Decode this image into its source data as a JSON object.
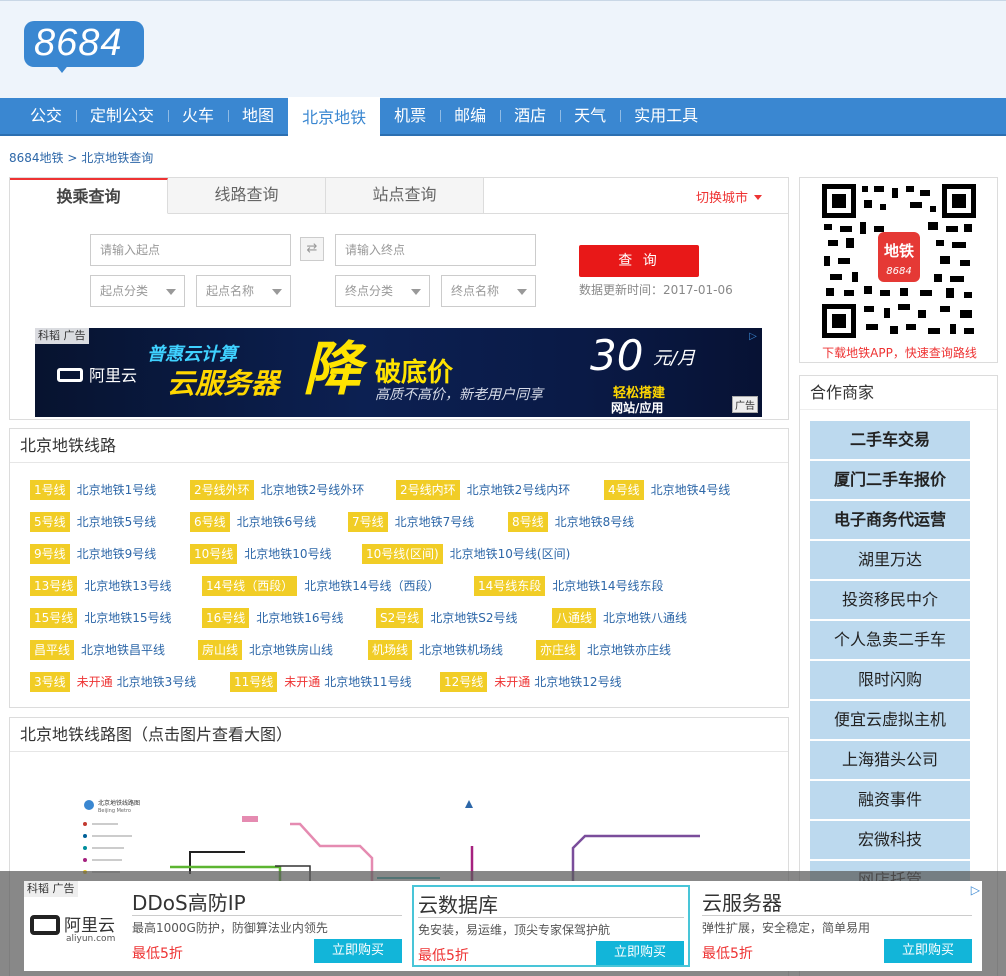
{
  "header": {
    "logo_text": "8684"
  },
  "nav": {
    "items": [
      "公交",
      "定制公交",
      "火车",
      "地图",
      "北京地铁",
      "机票",
      "邮编",
      "酒店",
      "天气",
      "实用工具"
    ],
    "active_index": 4
  },
  "breadcrumb": {
    "home": "8684地铁",
    "sep": " > ",
    "current": "北京地铁查询"
  },
  "query": {
    "tabs": [
      "换乘查询",
      "线路查询",
      "站点查询"
    ],
    "switch_city": "切换城市",
    "start_placeholder": "请输入起点",
    "end_placeholder": "请输入终点",
    "start_category": "起点分类",
    "start_name": "起点名称",
    "end_category": "终点分类",
    "end_name": "终点名称",
    "search_button": "查 询",
    "update_text": "数据更新时间：2017-01-06"
  },
  "ad_banner": {
    "tag": "科韬 广告",
    "brand": "阿里云",
    "line1": "普惠云计算",
    "line2": "云服务器",
    "big": "降",
    "line3": "破底价",
    "desc": "高质不高价，新老用户同享",
    "price": "30",
    "unit": "元/月",
    "easy": "轻松搭建",
    "site": "网站/应用",
    "corner": "广告"
  },
  "lines_panel": {
    "title": "北京地铁线路",
    "rows": [
      [
        {
          "badge": "1号线",
          "name": "北京地铁1号线"
        },
        {
          "badge": "2号线外环",
          "name": "北京地铁2号线外环"
        },
        {
          "badge": "2号线内环",
          "name": "北京地铁2号线内环"
        },
        {
          "badge": "4号线",
          "name": "北京地铁4号线"
        }
      ],
      [
        {
          "badge": "5号线",
          "name": "北京地铁5号线"
        },
        {
          "badge": "6号线",
          "name": "北京地铁6号线"
        },
        {
          "badge": "7号线",
          "name": "北京地铁7号线"
        },
        {
          "badge": "8号线",
          "name": "北京地铁8号线"
        }
      ],
      [
        {
          "badge": "9号线",
          "name": "北京地铁9号线"
        },
        {
          "badge": "10号线",
          "name": "北京地铁10号线"
        },
        {
          "badge": "10号线(区间)",
          "name": "北京地铁10号线(区间)"
        }
      ],
      [
        {
          "badge": "13号线",
          "name": "北京地铁13号线"
        },
        {
          "badge": "14号线（西段）",
          "name": "北京地铁14号线（西段）"
        },
        {
          "badge": "14号线东段",
          "name": "北京地铁14号线东段"
        }
      ],
      [
        {
          "badge": "15号线",
          "name": "北京地铁15号线"
        },
        {
          "badge": "16号线",
          "name": "北京地铁16号线"
        },
        {
          "badge": "S2号线",
          "name": "北京地铁S2号线"
        },
        {
          "badge": "八通线",
          "name": "北京地铁八通线"
        }
      ],
      [
        {
          "badge": "昌平线",
          "name": "北京地铁昌平线"
        },
        {
          "badge": "房山线",
          "name": "北京地铁房山线"
        },
        {
          "badge": "机场线",
          "name": "北京地铁机场线"
        },
        {
          "badge": "亦庄线",
          "name": "北京地铁亦庄线"
        }
      ],
      [
        {
          "badge": "3号线",
          "status": "未开通",
          "name": "北京地铁3号线"
        },
        {
          "badge": "11号线",
          "status": "未开通",
          "name": "北京地铁11号线"
        },
        {
          "badge": "12号线",
          "status": "未开通",
          "name": "北京地铁12号线"
        }
      ]
    ]
  },
  "map_panel": {
    "title": "北京地铁线路图（点击图片查看大图）",
    "map_title": "北京地铁线路图",
    "map_subtitle": "Beijing Metro"
  },
  "qr": {
    "app_name": "地铁",
    "app_number": "8684",
    "caption": "下载地铁APP，快速查询路线"
  },
  "partners": {
    "title": "合作商家",
    "items": [
      {
        "label": "二手车交易",
        "bold": true
      },
      {
        "label": "厦门二手车报价",
        "bold": true
      },
      {
        "label": "电子商务代运营",
        "bold": true
      },
      {
        "label": "湖里万达",
        "bold": false
      },
      {
        "label": "投资移民中介",
        "bold": false
      },
      {
        "label": "个人急卖二手车",
        "bold": false
      },
      {
        "label": "限时闪购",
        "bold": false
      },
      {
        "label": "便宜云虚拟主机",
        "bold": false
      },
      {
        "label": "上海猎头公司",
        "bold": false
      },
      {
        "label": "融资事件",
        "bold": false
      },
      {
        "label": "宏微科技",
        "bold": false
      },
      {
        "label": "网店托管",
        "bold": false
      }
    ]
  },
  "bottom_ad": {
    "tag": "科韬 广告",
    "brand": "阿里云",
    "brand_sub": "aliyun.com",
    "cards": [
      {
        "title": "DDoS高防IP",
        "desc": "最高1000G防护，防御算法业内领先",
        "price": "最低5折",
        "button": "立即购买"
      },
      {
        "title": "云数据库",
        "desc": "免安装，易运维，顶尖专家保驾护航",
        "price": "最低5折",
        "button": "立即购买"
      },
      {
        "title": "云服务器",
        "desc": "弹性扩展，安全稳定，简单易用",
        "price": "最低5折",
        "button": "立即购买"
      }
    ]
  },
  "colors": {
    "brand_blue": "#3a87d1",
    "accent_red": "#e81818",
    "badge_yellow": "#f1cd26",
    "partner_bg": "#bcd9ee"
  }
}
